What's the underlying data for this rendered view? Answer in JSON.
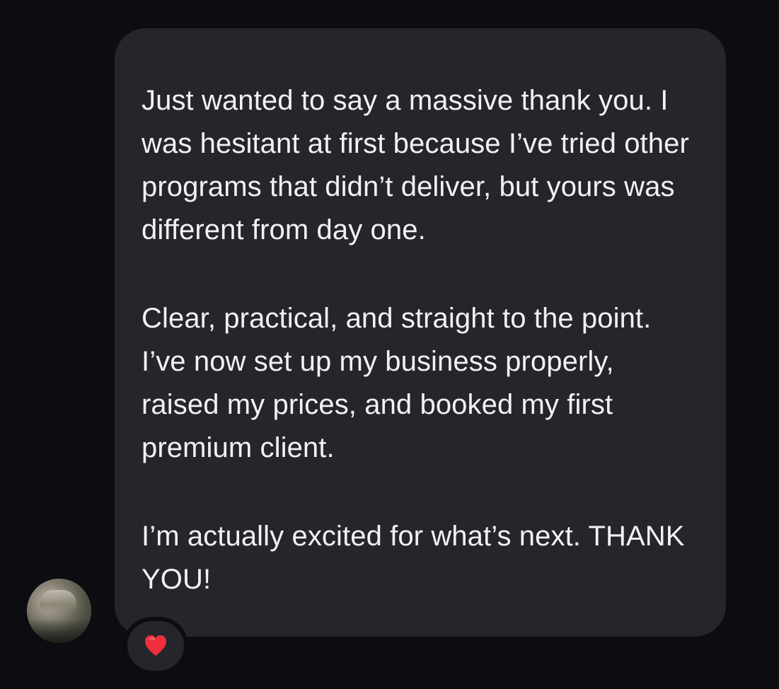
{
  "message": {
    "paragraphs": [
      "Just wanted to say a massive thank you. I was hesitant at first because I’ve tried other programs that didn’t deliver, but yours was different from day one.",
      "Clear, practical, and straight to the point. I’ve now set up my business properly, raised my prices, and booked my first premium client.",
      " I’m actually excited for what’s next. THANK YOU!"
    ]
  },
  "reaction": {
    "icon": "heart-icon",
    "color": "#ef2f3d"
  },
  "colors": {
    "background": "#0b0d10",
    "bubble": "#24262b",
    "text": "#f2f2f3"
  }
}
